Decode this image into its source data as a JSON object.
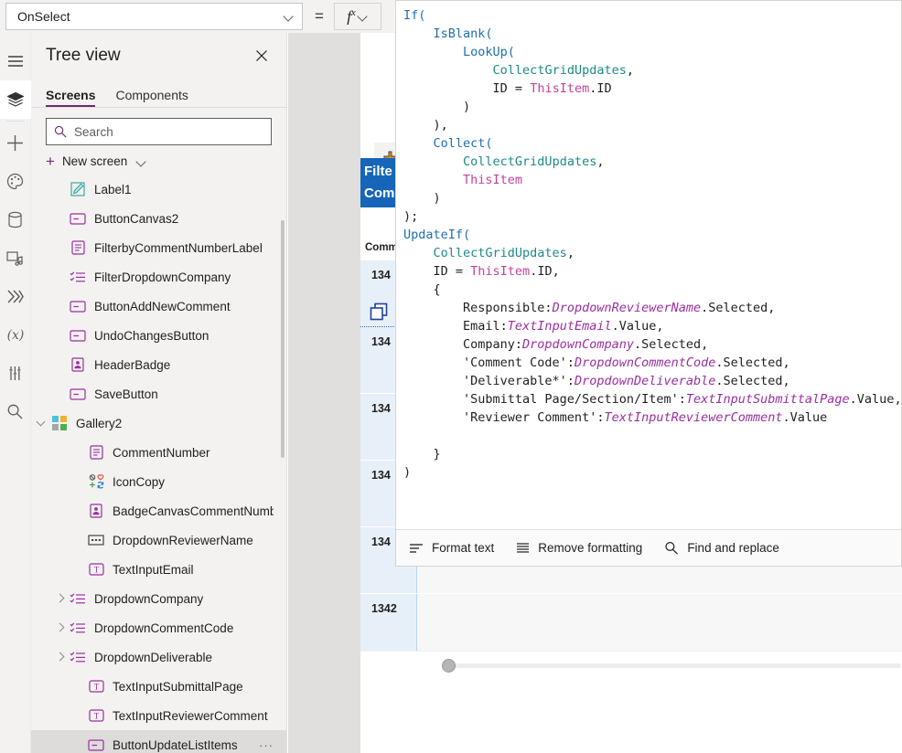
{
  "topbar": {
    "property_selector": {
      "value": "OnSelect",
      "icon": "chevron-down-icon"
    },
    "equals_sign": "=",
    "fx_button": {
      "label": "fx",
      "sup": "x",
      "icon": "chevron-down-icon"
    }
  },
  "rail": {
    "items": [
      {
        "name": "menu-icon",
        "title": "Menu"
      },
      {
        "name": "tree-view-icon",
        "title": "Tree view",
        "active": true
      },
      {
        "name": "insert-icon",
        "title": "Insert"
      },
      {
        "name": "theme-palette-icon",
        "title": "Theme"
      },
      {
        "name": "data-icon",
        "title": "Data"
      },
      {
        "name": "media-icon",
        "title": "Media"
      },
      {
        "name": "power-automate-icon",
        "title": "Power Automate"
      },
      {
        "name": "variables-icon",
        "title": "Variables"
      },
      {
        "name": "tools-icon",
        "title": "Advanced tools"
      },
      {
        "name": "search-icon",
        "title": "Search"
      }
    ]
  },
  "treeview": {
    "title": "Tree view",
    "close_icon": "close-icon",
    "tabs": [
      {
        "label": "Screens",
        "selected": true
      },
      {
        "label": "Components",
        "selected": false
      }
    ],
    "search": {
      "placeholder": "Search",
      "value": "",
      "icon": "search-icon"
    },
    "new_screen": {
      "label": "New screen",
      "plus_icon": "plus-icon",
      "chevron": "chevron-down-icon"
    },
    "items": [
      {
        "label": "Label1",
        "icon": "label-icon",
        "indent": 2,
        "expand": "none",
        "selected": false
      },
      {
        "label": "ButtonCanvas2",
        "icon": "button-icon",
        "indent": 2,
        "expand": "none",
        "selected": false
      },
      {
        "label": "FilterbyCommentNumberLabel",
        "icon": "text-label-icon",
        "indent": 2,
        "expand": "none",
        "selected": false
      },
      {
        "label": "FilterDropdownCompany",
        "icon": "dropdown-list-icon",
        "indent": 2,
        "expand": "none",
        "selected": false
      },
      {
        "label": "ButtonAddNewComment",
        "icon": "button-icon",
        "indent": 2,
        "expand": "none",
        "selected": false
      },
      {
        "label": "UndoChangesButton",
        "icon": "button-icon",
        "indent": 2,
        "expand": "none",
        "selected": false
      },
      {
        "label": "HeaderBadge",
        "icon": "badge-icon",
        "indent": 2,
        "expand": "none",
        "selected": false
      },
      {
        "label": "SaveButton",
        "icon": "button-icon",
        "indent": 2,
        "expand": "none",
        "selected": false
      },
      {
        "label": "Gallery2",
        "icon": "gallery-icon",
        "indent": 1,
        "expand": "down",
        "selected": false
      },
      {
        "label": "CommentNumber",
        "icon": "text-label-icon",
        "indent": 3,
        "expand": "none",
        "selected": false
      },
      {
        "label": "IconCopy",
        "icon": "copy-shapes-icon",
        "indent": 3,
        "expand": "none",
        "selected": false
      },
      {
        "label": "BadgeCanvasCommentNumber",
        "icon": "badge-icon",
        "indent": 3,
        "expand": "none",
        "selected": false
      },
      {
        "label": "DropdownReviewerName",
        "icon": "combobox-icon",
        "indent": 3,
        "expand": "none",
        "selected": false
      },
      {
        "label": "TextInputEmail",
        "icon": "text-input-icon",
        "indent": 3,
        "expand": "none",
        "selected": false
      },
      {
        "label": "DropdownCompany",
        "icon": "dropdown-list-icon",
        "indent": 2,
        "expand": "right",
        "selected": false
      },
      {
        "label": "DropdownCommentCode",
        "icon": "dropdown-list-icon",
        "indent": 2,
        "expand": "right",
        "selected": false
      },
      {
        "label": "DropdownDeliverable",
        "icon": "dropdown-list-icon",
        "indent": 2,
        "expand": "right",
        "selected": false
      },
      {
        "label": "TextInputSubmittalPage",
        "icon": "text-input-icon",
        "indent": 3,
        "expand": "none",
        "selected": false
      },
      {
        "label": "TextInputReviewerComment",
        "icon": "text-input-icon",
        "indent": 3,
        "expand": "none",
        "selected": false
      },
      {
        "label": "ButtonUpdateListItems",
        "icon": "button-icon",
        "indent": 3,
        "expand": "none",
        "selected": true,
        "overflow": "···"
      }
    ]
  },
  "canvas": {
    "add_button_icon": "add-item-icon",
    "header_banner": {
      "line1": "Filte",
      "line2": "Com",
      "color": "#1566b8"
    },
    "column_header": "Comm",
    "gallery_rows": [
      {
        "number": "134",
        "selected": true
      },
      {
        "number": "134",
        "selected": false
      },
      {
        "number": "134",
        "selected": false
      },
      {
        "number": "134",
        "selected": false
      },
      {
        "number": "134",
        "selected": false
      },
      {
        "number": "1342",
        "selected": false
      }
    ],
    "row_copy_icon": "copy-shapes-icon",
    "last_row_chevron": "chevron-down-icon",
    "hscrollbar": "horizontal-scrollbar"
  },
  "formula_editor": {
    "code_lines": [
      [
        [
          "fn",
          "If("
        ]
      ],
      [
        [
          "pln",
          "    "
        ],
        [
          "fn",
          "IsBlank("
        ]
      ],
      [
        [
          "pln",
          "        "
        ],
        [
          "fn",
          "LookUp("
        ]
      ],
      [
        [
          "pln",
          "            "
        ],
        [
          "tbl",
          "CollectGridUpdates"
        ],
        [
          "pln",
          ","
        ]
      ],
      [
        [
          "pln",
          "            "
        ],
        [
          "pln",
          "ID = "
        ],
        [
          "kw",
          "ThisItem"
        ],
        [
          "pln",
          ".ID"
        ]
      ],
      [
        [
          "pln",
          "        )"
        ]
      ],
      [
        [
          "pln",
          "    ),"
        ]
      ],
      [
        [
          "pln",
          "    "
        ],
        [
          "fn",
          "Collect("
        ]
      ],
      [
        [
          "pln",
          "        "
        ],
        [
          "tbl",
          "CollectGridUpdates"
        ],
        [
          "pln",
          ","
        ]
      ],
      [
        [
          "pln",
          "        "
        ],
        [
          "kw",
          "ThisItem"
        ]
      ],
      [
        [
          "pln",
          "    )"
        ]
      ],
      [
        [
          "pln",
          ");"
        ]
      ],
      [
        [
          "fn",
          "UpdateIf("
        ]
      ],
      [
        [
          "pln",
          "    "
        ],
        [
          "tbl",
          "CollectGridUpdates"
        ],
        [
          "pln",
          ","
        ]
      ],
      [
        [
          "pln",
          "    ID = "
        ],
        [
          "kw",
          "ThisItem"
        ],
        [
          "pln",
          ".ID,"
        ]
      ],
      [
        [
          "pln",
          "    {"
        ]
      ],
      [
        [
          "pln",
          "        Responsible:"
        ],
        [
          "ctl",
          "DropdownReviewerName"
        ],
        [
          "pln",
          ".Selected,"
        ]
      ],
      [
        [
          "pln",
          "        Email:"
        ],
        [
          "ctl",
          "TextInputEmail"
        ],
        [
          "pln",
          ".Value,"
        ]
      ],
      [
        [
          "pln",
          "        Company:"
        ],
        [
          "ctl",
          "DropdownCompany"
        ],
        [
          "pln",
          ".Selected,"
        ]
      ],
      [
        [
          "pln",
          "        'Comment Code':"
        ],
        [
          "ctl",
          "DropdownCommentCode"
        ],
        [
          "pln",
          ".Selected,"
        ]
      ],
      [
        [
          "pln",
          "        'Deliverable*':"
        ],
        [
          "ctl",
          "DropdownDeliverable"
        ],
        [
          "pln",
          ".Selected,"
        ]
      ],
      [
        [
          "pln",
          "        'Submittal Page/Section/Item':"
        ],
        [
          "ctl",
          "TextInputSubmittalPage"
        ],
        [
          "pln",
          ".Value,"
        ]
      ],
      [
        [
          "pln",
          "        'Reviewer Comment':"
        ],
        [
          "ctl",
          "TextInputReviewerComment"
        ],
        [
          "pln",
          ".Value"
        ]
      ],
      [
        [
          "pln",
          ""
        ]
      ],
      [
        [
          "pln",
          "    }"
        ]
      ],
      [
        [
          "pln",
          ")"
        ]
      ]
    ],
    "toolbar": [
      {
        "label": "Format text",
        "icon": "format-text-icon"
      },
      {
        "label": "Remove formatting",
        "icon": "remove-formatting-icon"
      },
      {
        "label": "Find and replace",
        "icon": "search-icon"
      }
    ],
    "colors": {
      "function": "#1f6fb2",
      "table": "#1d8a86",
      "keyword": "#c4419b",
      "control": "#9a2fa0",
      "plain": "#201f1e"
    }
  }
}
